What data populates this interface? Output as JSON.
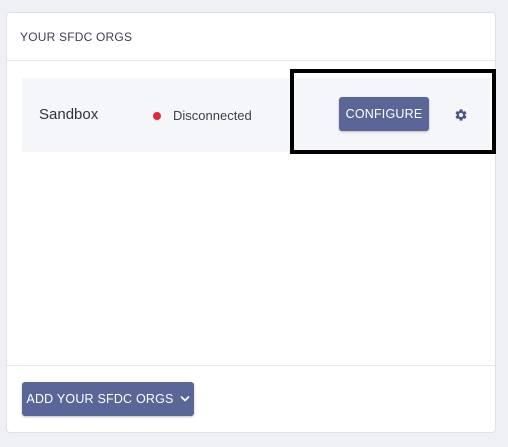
{
  "panel": {
    "title": "YOUR SFDC ORGS"
  },
  "orgs": [
    {
      "name": "Sandbox",
      "status": "Disconnected",
      "status_color": "#e8243a",
      "configure_label": "CONFIGURE",
      "settings_icon": "gear-icon"
    }
  ],
  "footer": {
    "add_label": "ADD YOUR SFDC ORGS",
    "add_icon": "chevron-down-icon"
  },
  "colors": {
    "button": "#5a6697",
    "row_background": "#f5f6fa",
    "page_background": "#eef0f5",
    "highlight": "#000000"
  }
}
